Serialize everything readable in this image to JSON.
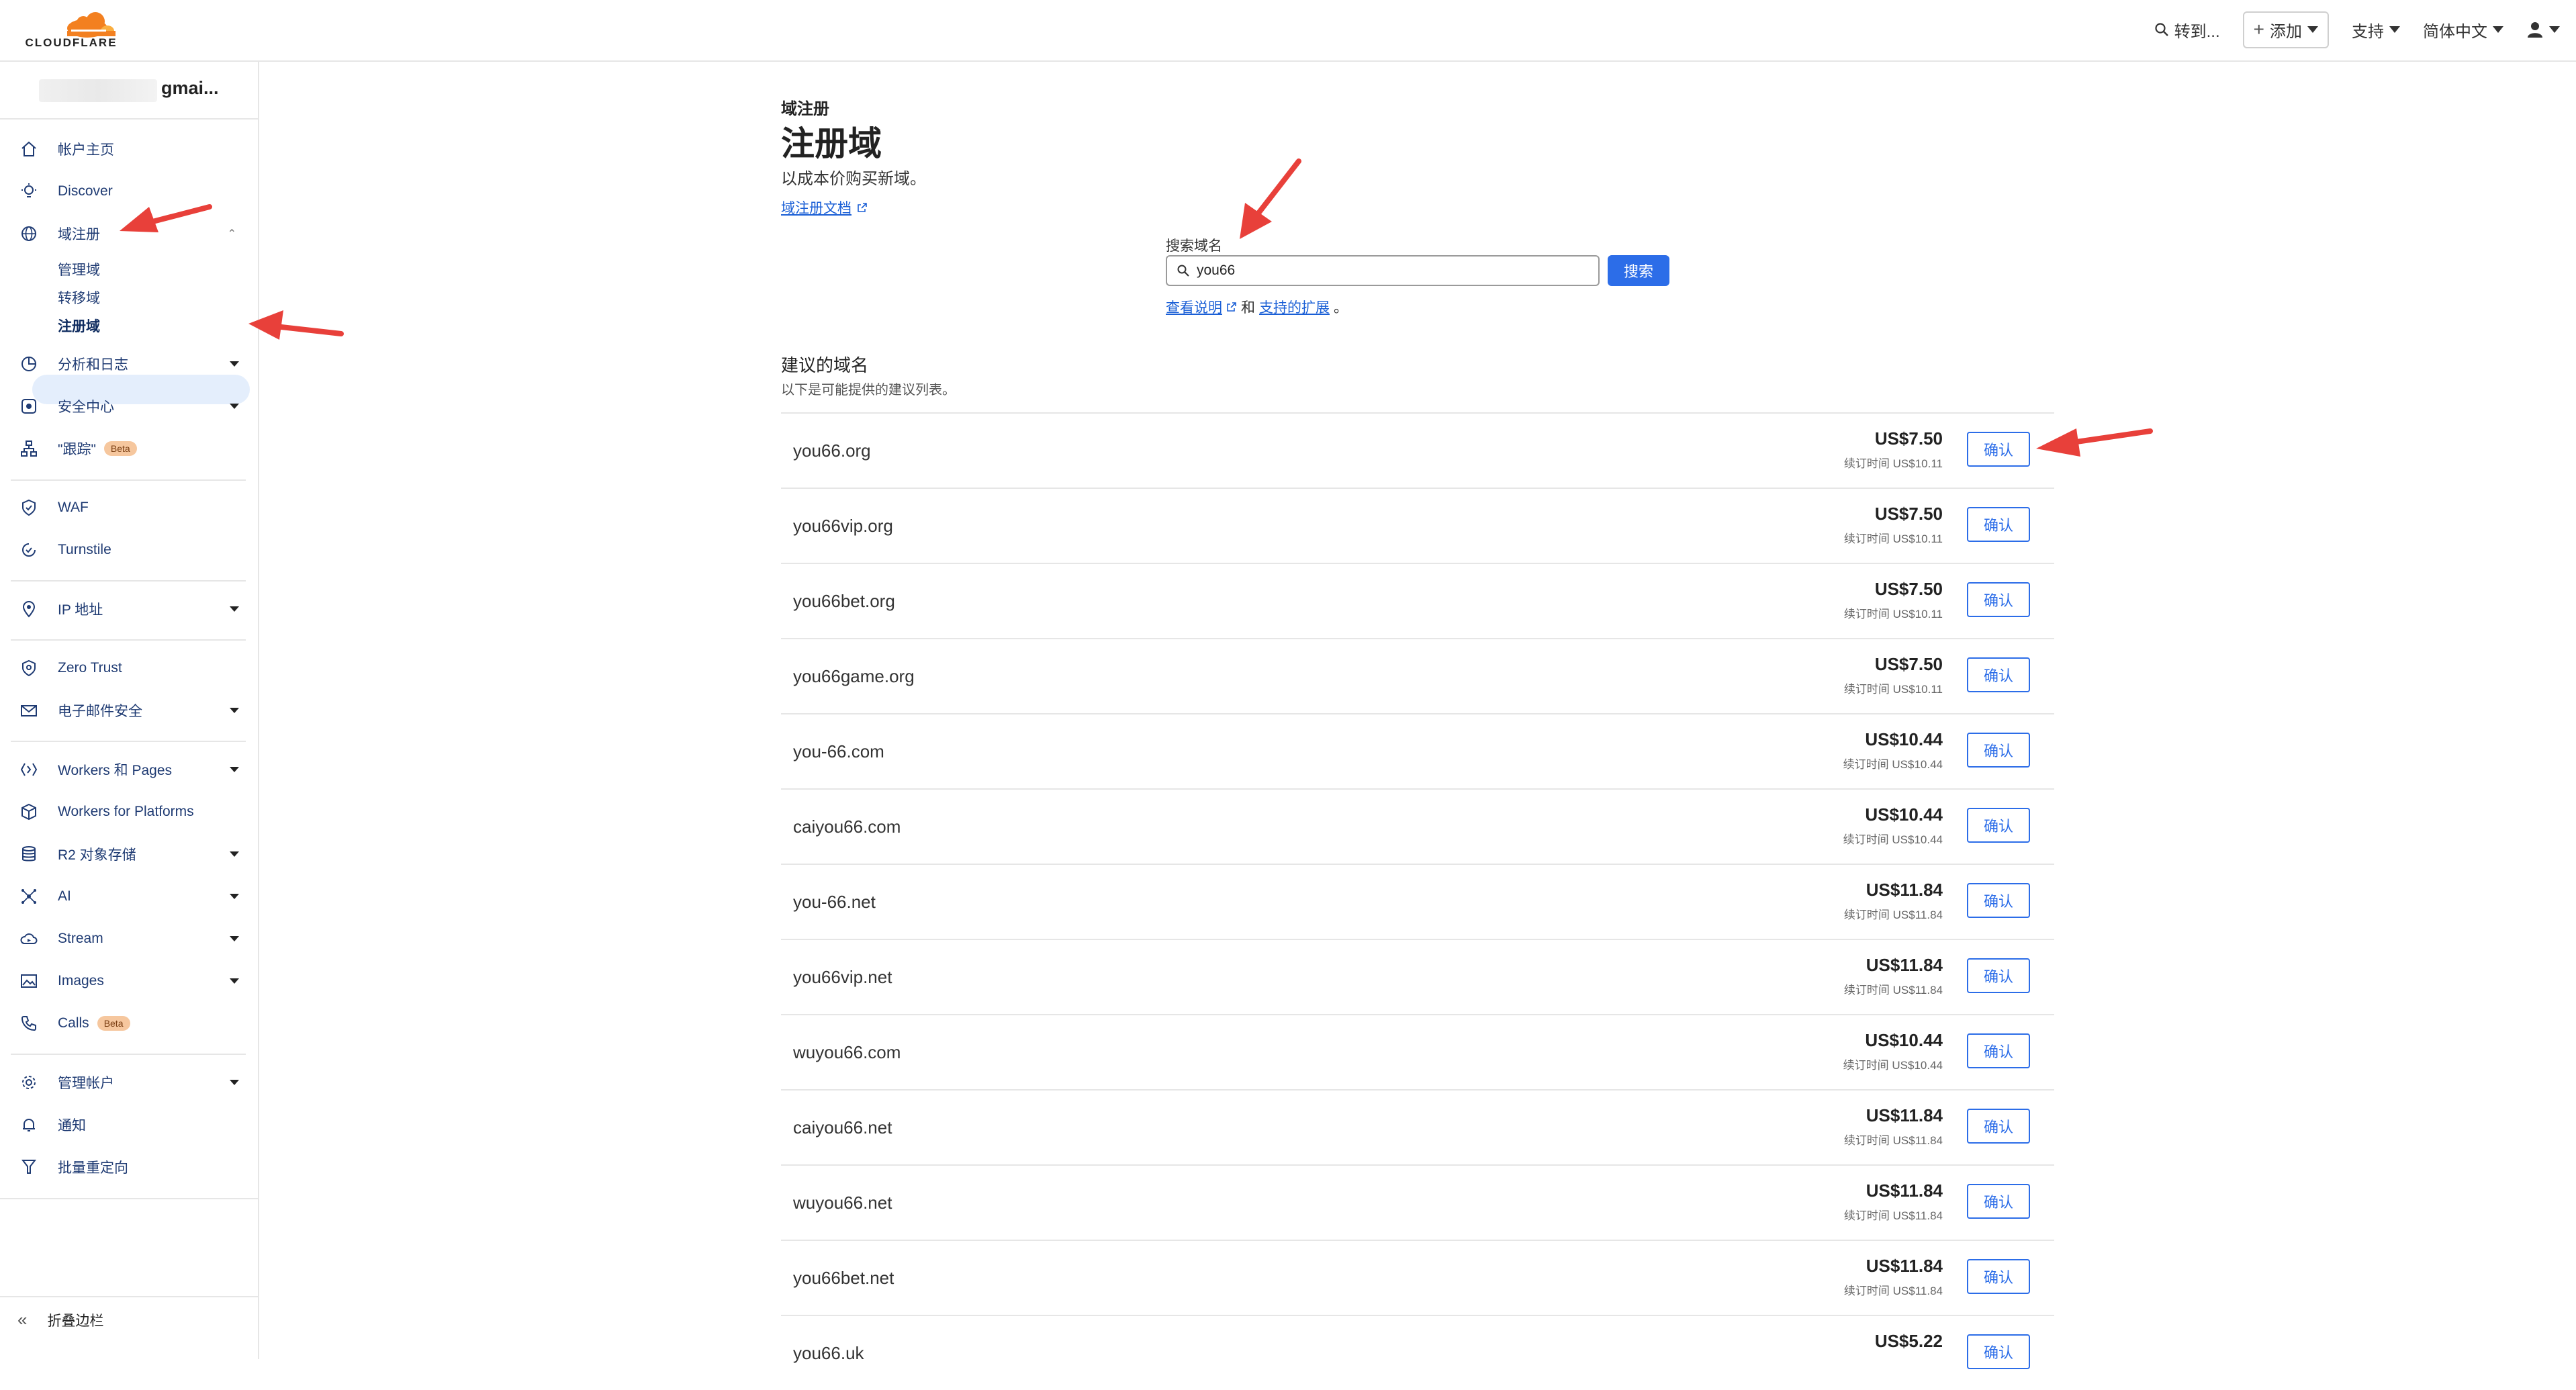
{
  "brand": {
    "logo_text": "CLOUDFLARE",
    "accent": "#f38020"
  },
  "topbar": {
    "goto_label": "转到...",
    "add_label": "添加",
    "support_label": "支持",
    "language_label": "简体中文"
  },
  "account": {
    "name": "gmai..."
  },
  "sidebar": {
    "items": [
      {
        "label": "帐户主页",
        "icon": "home-icon"
      },
      {
        "label": "Discover",
        "icon": "bulb-icon"
      },
      {
        "label": "域注册",
        "icon": "globe-icon"
      },
      {
        "label": "分析和日志",
        "icon": "chart-icon"
      },
      {
        "label": "安全中心",
        "icon": "shield-square-icon"
      },
      {
        "label": "\"跟踪\"",
        "icon": "network-icon",
        "badge": "Beta"
      },
      {
        "label": "WAF",
        "icon": "waf-icon"
      },
      {
        "label": "Turnstile",
        "icon": "turnstile-icon"
      },
      {
        "label": "IP 地址",
        "icon": "pin-icon"
      },
      {
        "label": "Zero Trust",
        "icon": "zero-trust-icon"
      },
      {
        "label": "电子邮件安全",
        "icon": "email-icon"
      },
      {
        "label": "Workers 和 Pages",
        "icon": "workers-icon"
      },
      {
        "label": "Workers for Platforms",
        "icon": "cube-icon"
      },
      {
        "label": "R2 对象存储",
        "icon": "database-icon"
      },
      {
        "label": "AI",
        "icon": "ai-icon"
      },
      {
        "label": "Stream",
        "icon": "cloud-icon"
      },
      {
        "label": "Images",
        "icon": "image-icon"
      },
      {
        "label": "Calls",
        "icon": "phone-icon",
        "badge": "Beta"
      },
      {
        "label": "管理帐户",
        "icon": "gear-icon"
      },
      {
        "label": "通知",
        "icon": "bell-icon"
      },
      {
        "label": "批量重定向",
        "icon": "redirect-icon"
      }
    ],
    "sub_items": [
      "管理域",
      "转移域",
      "注册域"
    ],
    "collapse_label": "折叠边栏"
  },
  "main": {
    "breadcrumb": "域注册",
    "title": "注册域",
    "subtitle": "以成本价购买新域。",
    "doc_link": "域注册文档",
    "search": {
      "label": "搜索域名",
      "value": "you66",
      "button": "搜索",
      "help_prefix": "查看说明",
      "help_and": "和",
      "help_link2": "支持的扩展",
      "help_suffix": "。"
    },
    "suggest_title": "建议的域名",
    "suggest_sub": "以下是可能提供的建议列表。",
    "confirm_label": "确认",
    "results": [
      {
        "name": "you66.org",
        "price": "US$7.50",
        "renew": "续订时间 US$10.11"
      },
      {
        "name": "you66vip.org",
        "price": "US$7.50",
        "renew": "续订时间 US$10.11"
      },
      {
        "name": "you66bet.org",
        "price": "US$7.50",
        "renew": "续订时间 US$10.11"
      },
      {
        "name": "you66game.org",
        "price": "US$7.50",
        "renew": "续订时间 US$10.11"
      },
      {
        "name": "you-66.com",
        "price": "US$10.44",
        "renew": "续订时间 US$10.44"
      },
      {
        "name": "caiyou66.com",
        "price": "US$10.44",
        "renew": "续订时间 US$10.44"
      },
      {
        "name": "you-66.net",
        "price": "US$11.84",
        "renew": "续订时间 US$11.84"
      },
      {
        "name": "you66vip.net",
        "price": "US$11.84",
        "renew": "续订时间 US$11.84"
      },
      {
        "name": "wuyou66.com",
        "price": "US$10.44",
        "renew": "续订时间 US$10.44"
      },
      {
        "name": "caiyou66.net",
        "price": "US$11.84",
        "renew": "续订时间 US$11.84"
      },
      {
        "name": "wuyou66.net",
        "price": "US$11.84",
        "renew": "续订时间 US$11.84"
      },
      {
        "name": "you66bet.net",
        "price": "US$11.84",
        "renew": "续订时间 US$11.84"
      },
      {
        "name": "you66.uk",
        "price": "US$5.22",
        "renew": ""
      }
    ]
  },
  "colors": {
    "link": "#1a5fd6",
    "primary_button": "#2c6de8",
    "annotation_arrow": "#e8403a",
    "active_nav_bg": "#e4eefc"
  }
}
